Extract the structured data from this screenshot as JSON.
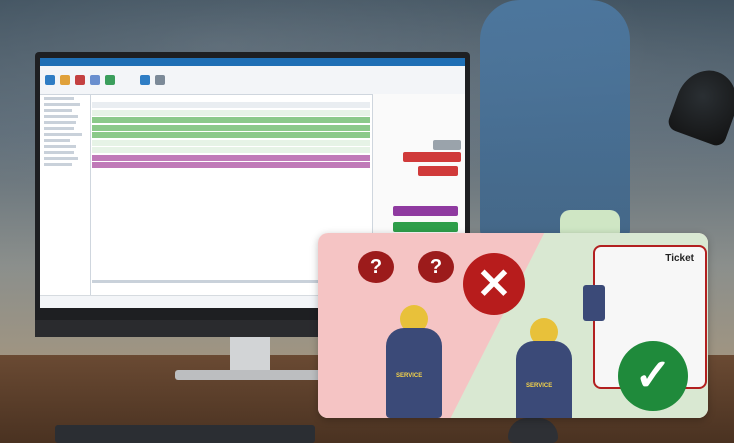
{
  "monitor_app": {
    "window_title": "",
    "ribbon_icons": [
      "new-icon",
      "folder-icon",
      "gear-icon",
      "user-icon",
      "chart-icon",
      "refresh-icon",
      "print-icon"
    ]
  },
  "illustration": {
    "ticket_label": "Ticket",
    "question_mark": "?",
    "service_text": "SERVICE",
    "cross_symbol": "✕",
    "check_symbol": "✓"
  },
  "colors": {
    "accent_blue": "#1f6fb5",
    "row_green": "#8bc98a",
    "row_magenta": "#c07ab8",
    "ticket_red": "#b22020",
    "success_green": "#1f8a3b",
    "error_red": "#b71c1c"
  }
}
